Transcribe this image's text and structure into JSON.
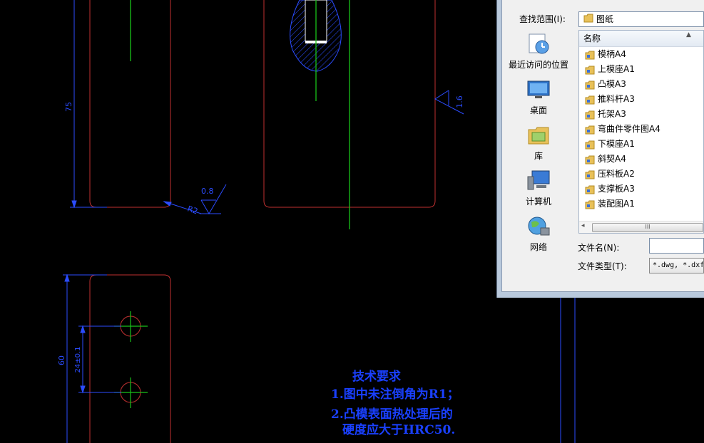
{
  "drawing": {
    "dims": {
      "d75": "75",
      "d60": "60",
      "d24": "24±0.1",
      "r2": "R2",
      "rough08": "0.8",
      "rough16": "1.6"
    },
    "tech_req": {
      "title": "技术要求",
      "line1": "1.图中未注倒角为R1；",
      "line2": "2.凸模表面热处理后的",
      "line3": "硬度应大于HRC50."
    },
    "colors": {
      "outline": "#c03030",
      "dim": "#2b4cff",
      "center": "#19c219",
      "text": "#1a40ff"
    }
  },
  "dialog": {
    "lookin_label": "查找范围(I):",
    "lookin_value": "图纸",
    "places": [
      {
        "label": "最近访问的位置",
        "icon": "recent-places-icon"
      },
      {
        "label": "桌面",
        "icon": "desktop-icon"
      },
      {
        "label": "库",
        "icon": "libraries-icon"
      },
      {
        "label": "计算机",
        "icon": "computer-icon"
      },
      {
        "label": "网络",
        "icon": "network-icon"
      }
    ],
    "column_name": "名称",
    "files": [
      "模柄A4",
      "上模座A1",
      "凸模A3",
      "推料杆A3",
      "托架A3",
      "弯曲件零件图A4",
      "下模座A1",
      "斜契A4",
      "压料板A2",
      "支撑板A3",
      "装配图A1"
    ],
    "filename_label": "文件名(N):",
    "filename_value": "",
    "filetype_label": "文件类型(T):",
    "filetype_value": "*.dwg, *.dxf",
    "scroll_mark": "III"
  }
}
